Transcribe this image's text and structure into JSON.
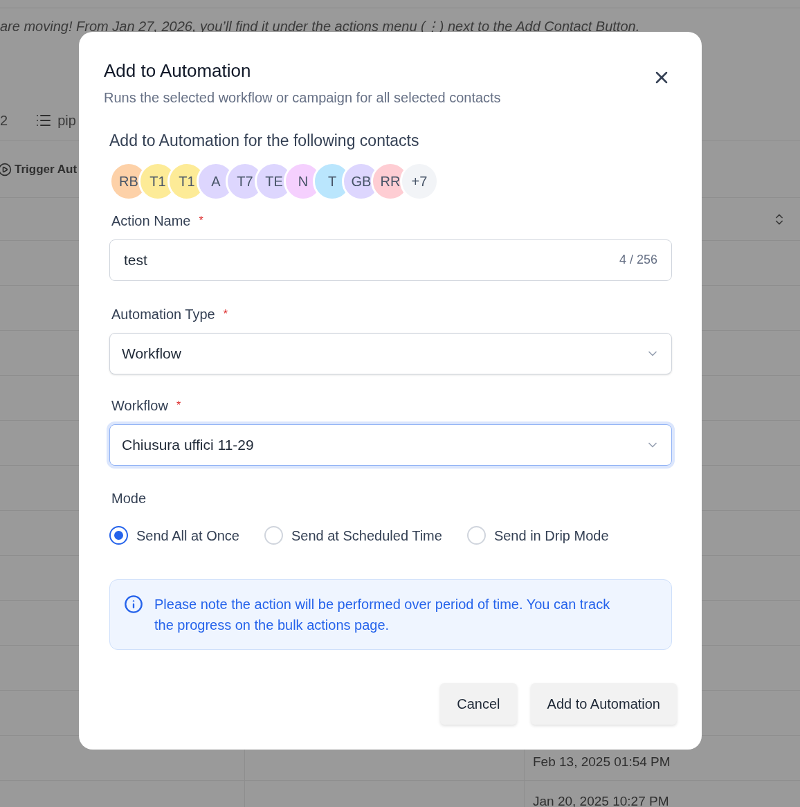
{
  "background": {
    "banner": "are moving! From Jan 27, 2026, you’ll find it under the actions menu (⋮) next to the Add Contact Button.",
    "toolbar": {
      "count": "2",
      "view_label": "pip"
    },
    "trigger_label": "Trigger Aut",
    "dates": [
      "Feb 13, 2025 01:54 PM",
      "Jan 20, 2025 10:27 PM"
    ]
  },
  "dialog": {
    "title": "Add to Automation",
    "subtitle": "Runs the selected workflow or campaign for all selected contacts",
    "contacts_heading": "Add to Automation for the following contacts",
    "contacts": [
      {
        "initials": "RB",
        "color": "#fdd1a8"
      },
      {
        "initials": "T1",
        "color": "#fdeb97"
      },
      {
        "initials": "T1",
        "color": "#fdeb97"
      },
      {
        "initials": "A",
        "color": "#ddd6fe"
      },
      {
        "initials": "T7",
        "color": "#ddd6fe"
      },
      {
        "initials": "TE",
        "color": "#ddd6fe"
      },
      {
        "initials": "N",
        "color": "#f5d0fe"
      },
      {
        "initials": "T",
        "color": "#bae6fd"
      },
      {
        "initials": "GB",
        "color": "#ddd6fe"
      },
      {
        "initials": "RR",
        "color": "#fecdd3"
      }
    ],
    "more_contacts": "+7",
    "action_name": {
      "label": "Action Name",
      "required_mark": "*",
      "value": "test",
      "counter": "4 / 256"
    },
    "automation_type": {
      "label": "Automation Type",
      "required_mark": "*",
      "value": "Workflow",
      "focused": false
    },
    "workflow": {
      "label": "Workflow",
      "required_mark": "*",
      "value": "Chiusura uffici 11-29",
      "focused": true
    },
    "mode": {
      "label": "Mode",
      "options": [
        {
          "label": "Send All at Once",
          "selected": true
        },
        {
          "label": "Send at Scheduled Time",
          "selected": false
        },
        {
          "label": "Send in Drip Mode",
          "selected": false
        }
      ]
    },
    "note": "Please note the action will be performed over period of time. You can track the progress on the bulk actions page.",
    "buttons": [
      {
        "label": "Cancel"
      },
      {
        "label": "Add to Automation"
      }
    ]
  }
}
